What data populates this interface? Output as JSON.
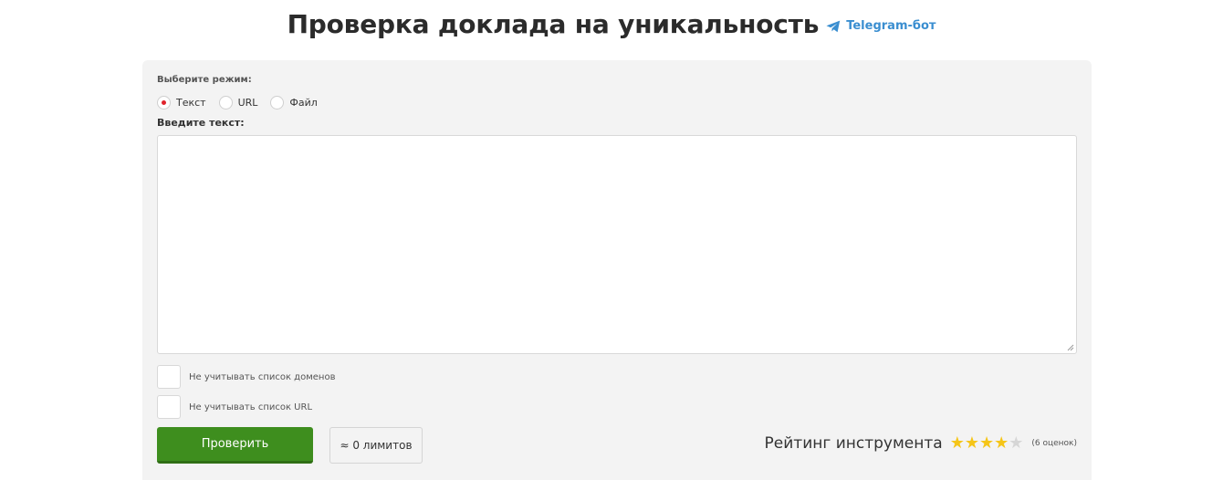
{
  "header": {
    "title": "Проверка доклада на уникальность",
    "telegram_label": "Telegram-бот",
    "telegram_icon": "telegram-plane-icon",
    "link_color": "#3a8ed0"
  },
  "form": {
    "mode_label": "Выберите режим:",
    "modes": [
      {
        "label": "Текст",
        "selected": true
      },
      {
        "label": "URL",
        "selected": false
      },
      {
        "label": "Файл",
        "selected": false
      }
    ],
    "text_label": "Введите текст:",
    "textarea_value": "",
    "options": [
      {
        "label": "Не учитывать список доменов",
        "checked": false
      },
      {
        "label": "Не учитывать список URL",
        "checked": false
      }
    ],
    "submit_label": "Проверить",
    "limits_label": "≈ 0 лимитов",
    "accent_color": "#3e8e1e",
    "radio_selected_color": "#e0232b"
  },
  "rating": {
    "label": "Рейтинг инструмента",
    "stars_filled": 4,
    "stars_total": 5,
    "count_text": "(6 оценок)",
    "star_color": "#f5c518",
    "star_empty_color": "#d6d6d6"
  }
}
